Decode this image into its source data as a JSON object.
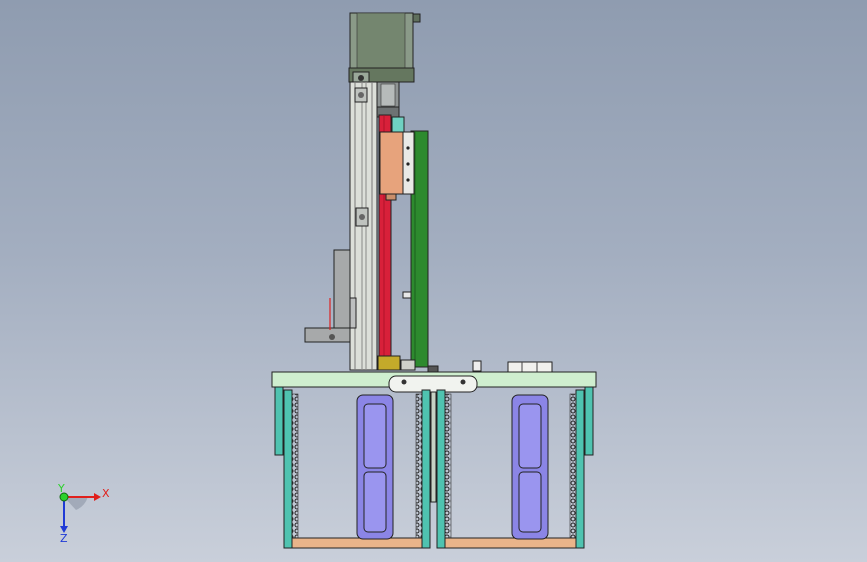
{
  "scene": {
    "type": "cad-assembly-side-view",
    "background_colors": [
      "#8f9cb0",
      "#c9cfda"
    ]
  },
  "colors": {
    "motor": "#7d8d7d",
    "aluminum": "#d9dcd6",
    "red_rail": "#d8203a",
    "green_bar": "#2d8a2e",
    "carriage": "#e7a37c",
    "base_plate": "#cfeecf",
    "cyan_frame": "#4fc3b0",
    "purple_pad": "#8b85e6",
    "bottom_plate": "#e9b48a"
  },
  "triad": {
    "x_label": "X",
    "y_label": "Y",
    "z_label": "Z",
    "x_color": "#e0201c",
    "y_color": "#2bd12b",
    "z_color": "#1f3ad6"
  }
}
